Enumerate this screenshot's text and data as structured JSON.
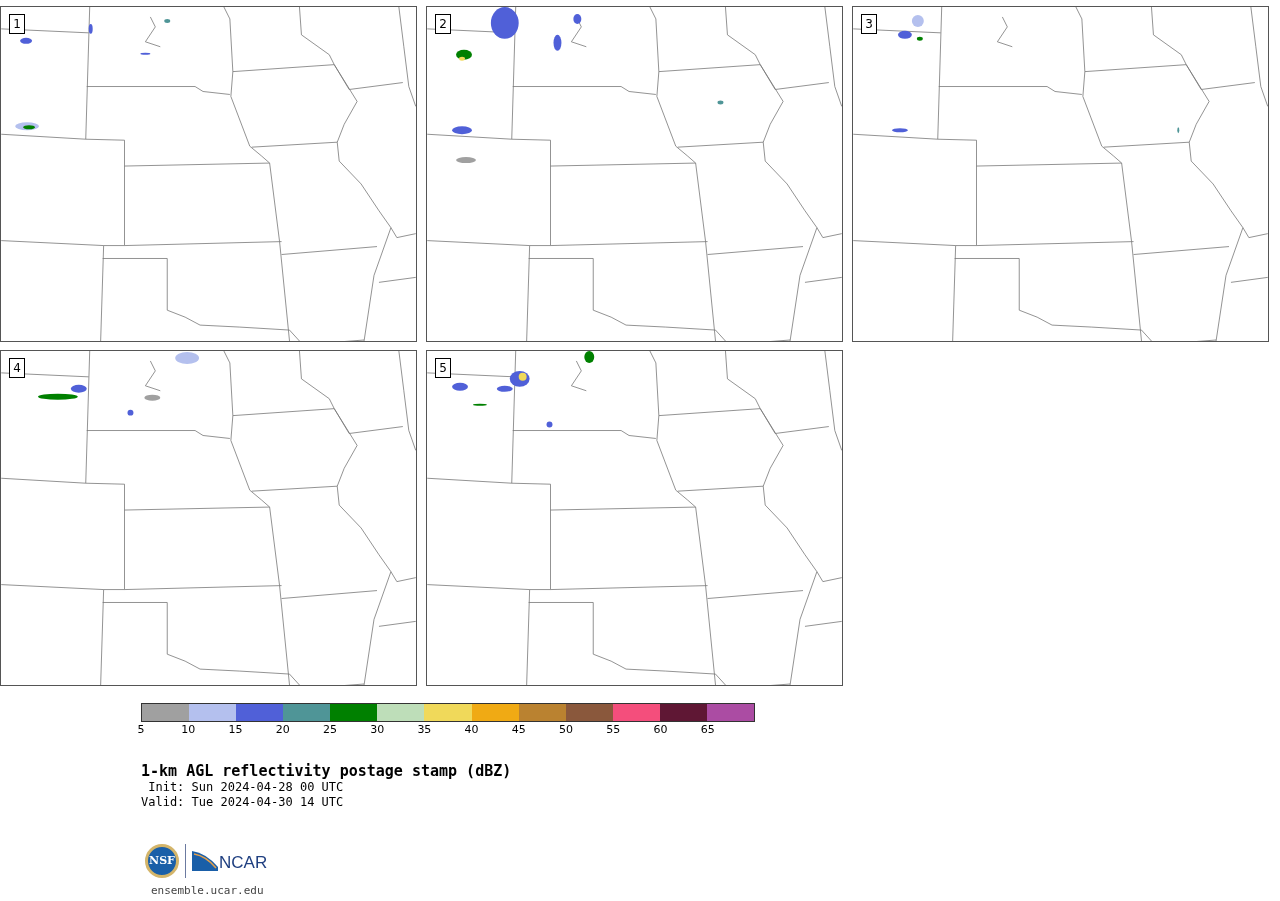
{
  "panels": [
    {
      "label": "1"
    },
    {
      "label": "2"
    },
    {
      "label": "3"
    },
    {
      "label": "4"
    },
    {
      "label": "5"
    }
  ],
  "colorbar": {
    "bins": [
      {
        "color": "#a0a0a0"
      },
      {
        "color": "#b4c0ee"
      },
      {
        "color": "#5060d8"
      },
      {
        "color": "#4f9597"
      },
      {
        "color": "#008000"
      },
      {
        "color": "#bedeb9"
      },
      {
        "color": "#f0d95a"
      },
      {
        "color": "#f0aa14"
      },
      {
        "color": "#ba8230"
      },
      {
        "color": "#8a583c"
      },
      {
        "color": "#f44e7c"
      },
      {
        "color": "#5f1734"
      },
      {
        "color": "#ab4ca3"
      }
    ],
    "ticks": [
      "5",
      "10",
      "15",
      "20",
      "25",
      "30",
      "35",
      "40",
      "45",
      "50",
      "55",
      "60",
      "65"
    ]
  },
  "title": "1-km AGL reflectivity postage stamp (dBZ)",
  "init": " Init: Sun 2024-04-28 00 UTC",
  "valid": "Valid: Tue 2024-04-30 14 UTC",
  "logo": {
    "nsf": "NSF",
    "ncar": "NCAR"
  },
  "footer": "ensemble.ucar.edu"
}
